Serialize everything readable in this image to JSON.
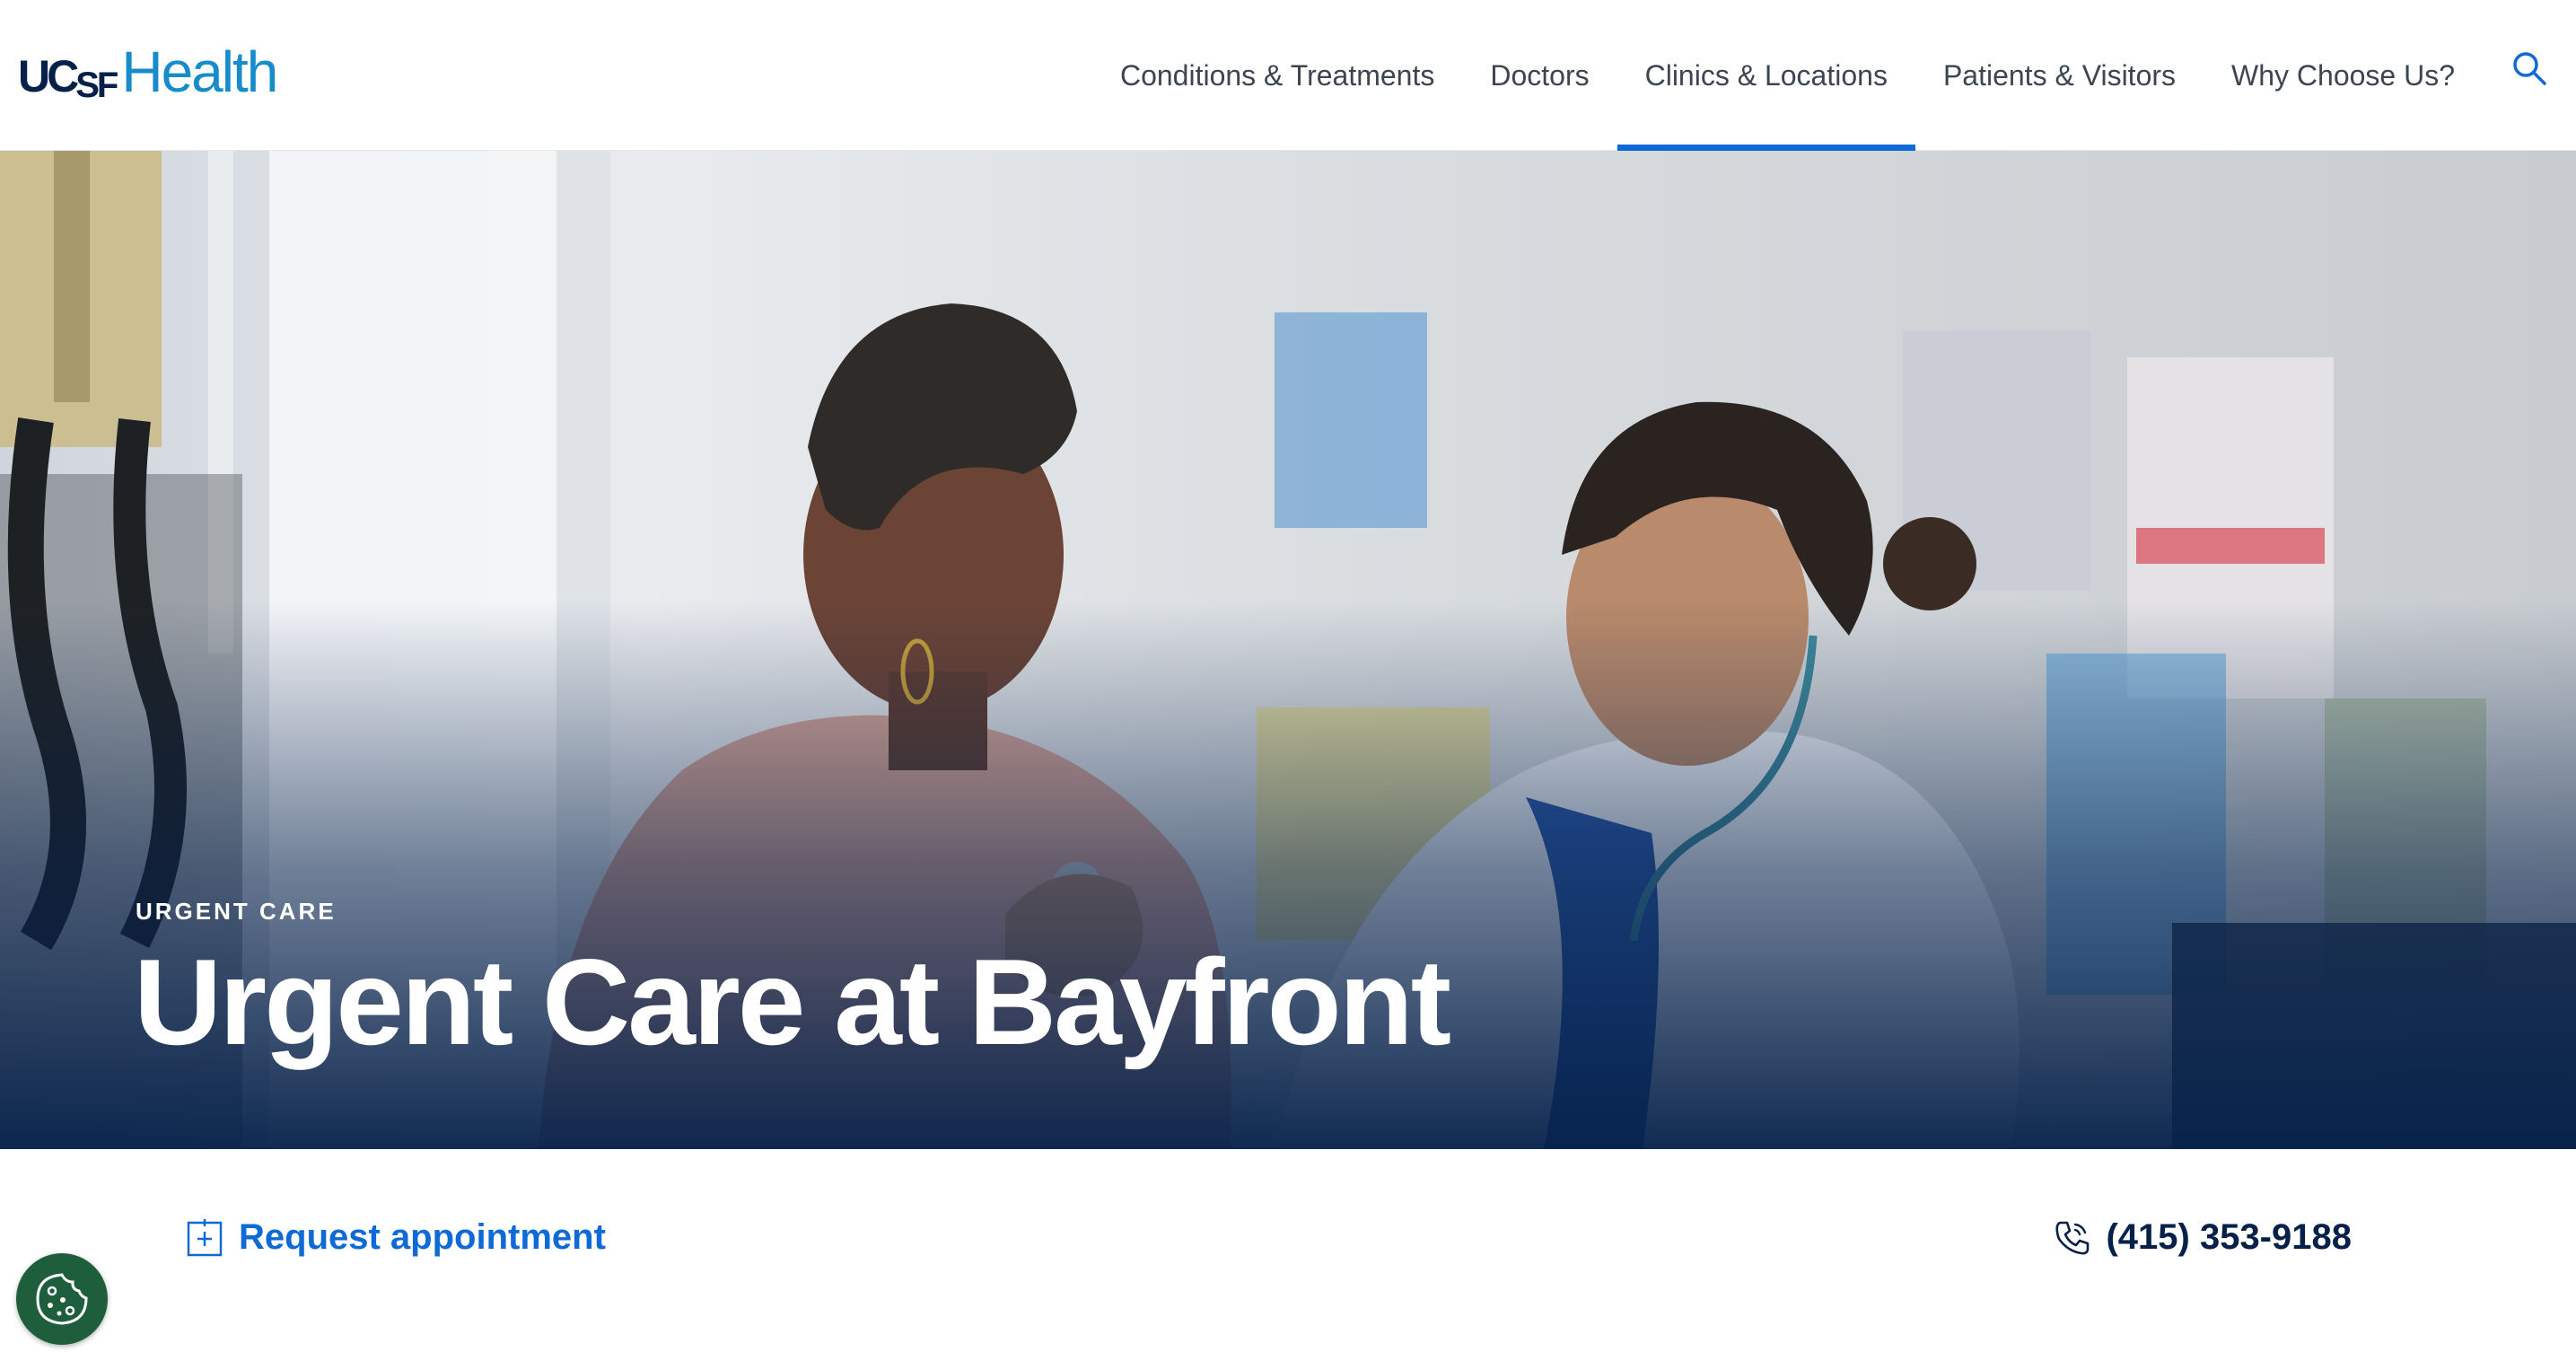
{
  "header": {
    "logo": {
      "ucsf": "UCSF",
      "health": "Health"
    },
    "nav": [
      {
        "label": "Conditions & Treatments",
        "active": false
      },
      {
        "label": "Doctors",
        "active": false
      },
      {
        "label": "Clinics & Locations",
        "active": true
      },
      {
        "label": "Patients & Visitors",
        "active": false
      },
      {
        "label": "Why Choose Us?",
        "active": false
      }
    ],
    "search_icon": "search-icon"
  },
  "hero": {
    "eyebrow": "URGENT CARE",
    "title": "Urgent Care at Bayfront",
    "image": "photo: doctor with stethoscope examining patient"
  },
  "actions": {
    "request_label": "Request appointment",
    "request_icon": "calendar-plus-icon",
    "phone": "(415) 353-9188",
    "phone_icon": "phone-icon"
  },
  "cookie": {
    "icon": "cookie-icon"
  },
  "colors": {
    "brand_navy": "#052049",
    "brand_blue": "#178ccb",
    "link_blue": "#0f6ad6",
    "cookie_green": "#1f5e3d"
  }
}
